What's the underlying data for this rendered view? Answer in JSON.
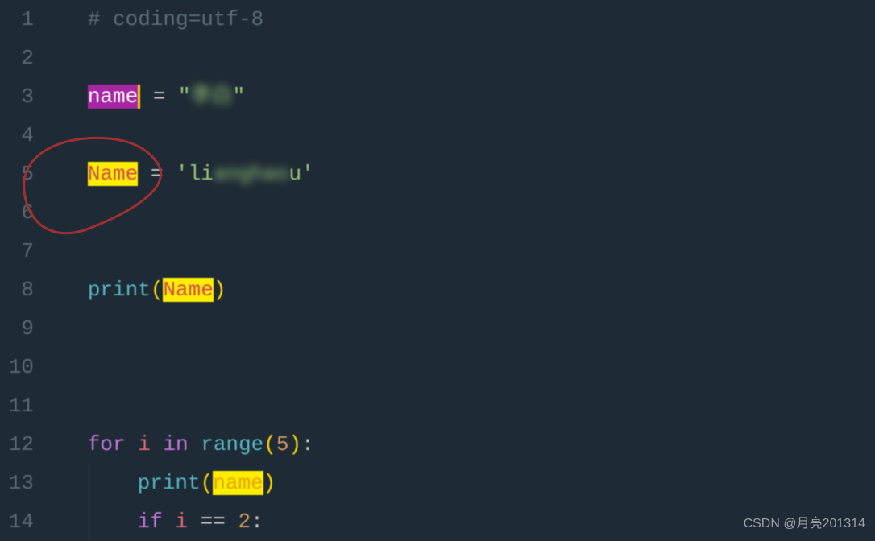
{
  "lines": {
    "1": "1",
    "2": "2",
    "3": "3",
    "4": "4",
    "5": "5",
    "6": "6",
    "7": "7",
    "8": "8",
    "9": "9",
    "10": "10",
    "11": "11",
    "12": "12",
    "13": "13",
    "14": "14"
  },
  "code": {
    "l1_comment": "# coding=utf-8",
    "l3_var": "name",
    "l3_eq": " = ",
    "l3_q1": "\"",
    "l3_str": "李白",
    "l3_q2": "\"",
    "l5_var": "Name",
    "l5_eq": " = ",
    "l5_q1": "'",
    "l5_pre": "li",
    "l5_mid": "anghao",
    "l5_post": "u",
    "l5_q2": "'",
    "l8_func": "print",
    "l8_open": "(",
    "l8_arg": "Name",
    "l8_close": ")",
    "l12_for": "for",
    "l12_var": " i ",
    "l12_in": "in",
    "l12_sp": " ",
    "l12_range": "range",
    "l12_open": "(",
    "l12_num": "5",
    "l12_close": ")",
    "l12_colon": ":",
    "l13_func": "print",
    "l13_open": "(",
    "l13_arg": "name",
    "l13_close": ")",
    "l14_if": "if",
    "l14_var": " i ",
    "l14_eq": "==",
    "l14_sp": " ",
    "l14_num": "2",
    "l14_colon": ":"
  },
  "watermark": "CSDN @月亮201314"
}
